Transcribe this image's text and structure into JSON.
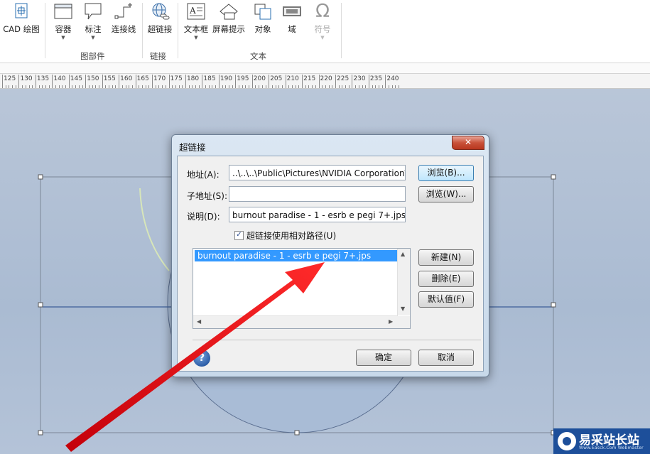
{
  "ribbon": {
    "cad_label": "CAD 绘图",
    "container_label": "容器",
    "callout_label": "标注",
    "connector_label": "连接线",
    "hyperlink_label": "超链接",
    "textbox_label": "文本框",
    "screentip_label": "屏幕提示",
    "object_label": "对象",
    "field_label": "域",
    "symbol_label": "符号",
    "group_parts": "图部件",
    "group_links": "链接",
    "group_text": "文本"
  },
  "ruler": {
    "labels": [
      "125",
      "130",
      "135",
      "140",
      "145",
      "150",
      "155",
      "160",
      "165",
      "170",
      "175",
      "180",
      "185",
      "190",
      "195",
      "200",
      "205",
      "210",
      "215",
      "220",
      "225",
      "230",
      "235",
      "240"
    ]
  },
  "dialog": {
    "title": "超链接",
    "close_symbol": "✕",
    "address_label": "地址(A):",
    "address_value": "..\\..\\..\\Public\\Pictures\\NVIDIA Corporation\\",
    "browse_b_label": "浏览(B)...",
    "subaddress_label": "子地址(S):",
    "subaddress_value": "",
    "browse_w_label": "浏览(W)...",
    "description_label": "说明(D):",
    "description_value": "burnout paradise - 1 - esrb e pegi 7+.jps",
    "relative_path_label": "超链接使用相对路径(U)",
    "relative_path_checked": true,
    "links": [
      "burnout paradise - 1 - esrb e pegi 7+.jps"
    ],
    "new_label": "新建(N)",
    "delete_label": "删除(E)",
    "default_label": "默认值(F)",
    "ok_label": "确定",
    "cancel_label": "取消"
  },
  "watermark": {
    "text": "易采站长站",
    "sub": "Www.Easck.Com Webmaster"
  },
  "colors": {
    "selection": "#3399ff",
    "canvas": "#aabbd2",
    "arrow": "#e8141b"
  }
}
